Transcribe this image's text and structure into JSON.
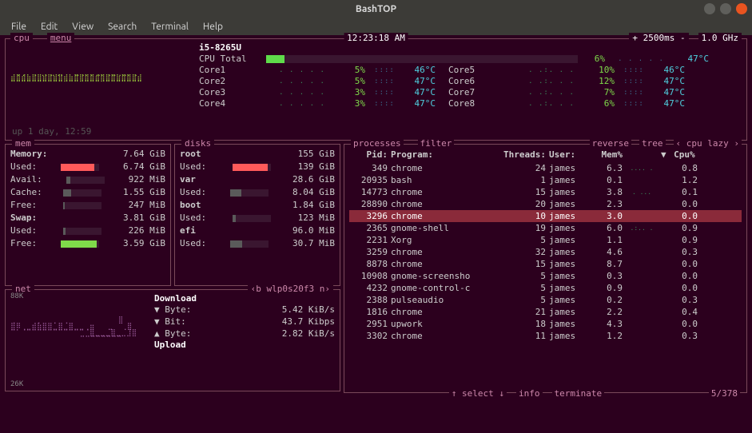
{
  "window": {
    "title": "BashTOP"
  },
  "menubar": [
    "File",
    "Edit",
    "View",
    "Search",
    "Terminal",
    "Help"
  ],
  "cpu": {
    "tab_cpu": "cpu",
    "tab_menu": "menu",
    "model": "i5-8265U",
    "clock": "12:23:18 AM",
    "interval_label": "+ 2500ms -",
    "freq": "1.0 GHz",
    "uptime": "up 1 day, 12:59",
    "total": {
      "label": "CPU Total",
      "pct": "6%",
      "temp": "47°C",
      "bar_pct": 6
    },
    "cores_left": [
      {
        "label": "Core1",
        "pct": "5%",
        "temp": "46°C",
        "tempc": "cyan"
      },
      {
        "label": "Core2",
        "pct": "5%",
        "temp": "47°C",
        "tempc": "cyan"
      },
      {
        "label": "Core3",
        "pct": "3%",
        "temp": "47°C",
        "tempc": "cyan"
      },
      {
        "label": "Core4",
        "pct": "3%",
        "temp": "47°C",
        "tempc": "cyan"
      }
    ],
    "cores_right": [
      {
        "label": "Core5",
        "pct": "10%",
        "temp": "46°C",
        "tempc": "cyan"
      },
      {
        "label": "Core6",
        "pct": "12%",
        "temp": "47°C",
        "tempc": "cyan"
      },
      {
        "label": "Core7",
        "pct": "7%",
        "temp": "47°C",
        "tempc": "cyan"
      },
      {
        "label": "Core8",
        "pct": "6%",
        "temp": "47°C",
        "tempc": "cyan"
      }
    ]
  },
  "mem": {
    "tab": "mem",
    "rows": [
      {
        "label": "Memory:",
        "val": "7.64 GiB",
        "bold": true
      },
      {
        "label": "Used:",
        "val": "6.74 GiB",
        "fill": 88,
        "color": "#ff5a5a"
      },
      {
        "label": "Avail:",
        "val": "922 MiB",
        "fill": 12,
        "color": "#5a5a5a"
      },
      {
        "label": "Cache:",
        "val": "1.55 GiB",
        "fill": 20,
        "color": "#5a5a5a"
      },
      {
        "label": "Free:",
        "val": "247 MiB",
        "fill": 3,
        "color": "#5a5a5a"
      },
      {
        "label": "Swap:",
        "val": "3.81 GiB",
        "bold": true
      },
      {
        "label": "Used:",
        "val": "226 MiB",
        "fill": 6,
        "color": "#5a5a5a"
      },
      {
        "label": "Free:",
        "val": "3.59 GiB",
        "fill": 94,
        "color": "#7fdb4a"
      }
    ]
  },
  "disks": {
    "tab": "disks",
    "rows": [
      {
        "label": "root",
        "val": "155 GiB",
        "bold": true
      },
      {
        "label": "Used:",
        "val": "139 GiB",
        "fill": 90,
        "color": "#ff5a5a"
      },
      {
        "label": "var",
        "val": "28.6 GiB",
        "bold": true
      },
      {
        "label": "Used:",
        "val": "8.04 GiB",
        "fill": 28,
        "color": "#5a5a5a"
      },
      {
        "label": "boot",
        "val": "1.84 GiB",
        "bold": true
      },
      {
        "label": "Used:",
        "val": "123 MiB",
        "fill": 7,
        "color": "#5a5a5a"
      },
      {
        "label": "efi",
        "val": "96.0 MiB",
        "bold": true
      },
      {
        "label": "Used:",
        "val": "30.7 MiB",
        "fill": 32,
        "color": "#5a5a5a"
      }
    ]
  },
  "net": {
    "tab": "net",
    "iface": "‹b wlp0s20f3 n›",
    "top_scale": "88K",
    "bot_scale": "26K",
    "dl_heading": "Download",
    "ul_heading": "Upload",
    "rows": [
      {
        "icon": "▼",
        "label": "Byte:",
        "val": "5.42 KiB/s"
      },
      {
        "icon": "▼",
        "label": "Bit:",
        "val": "43.7 Kibps"
      },
      {
        "icon": "▲",
        "label": "Byte:",
        "val": "2.82 KiB/s"
      }
    ]
  },
  "proc": {
    "tab_processes": "processes",
    "tab_filter": "filter",
    "tab_reverse": "reverse",
    "tab_tree": "tree",
    "tab_sort": "‹ cpu lazy ›",
    "hdr": {
      "pid": "Pid:",
      "prog": "Program:",
      "thr": "Threads:",
      "user": "User:",
      "mem": "Mem%",
      "cpu": "Cpu%",
      "arrow": "▼"
    },
    "rows": [
      {
        "pid": "349",
        "prog": "chrome",
        "thr": "24",
        "user": "james",
        "mem": "6.3",
        "cpu": "0.8",
        "spark": ".... ."
      },
      {
        "pid": "20935",
        "prog": "bash",
        "thr": "1",
        "user": "james",
        "mem": "0.1",
        "cpu": "1.2"
      },
      {
        "pid": "14773",
        "prog": "chrome",
        "thr": "15",
        "user": "james",
        "mem": "3.8",
        "cpu": "0.1",
        "spark": ".  ..."
      },
      {
        "pid": "28890",
        "prog": "chrome",
        "thr": "20",
        "user": "james",
        "mem": "2.3",
        "cpu": "0.0"
      },
      {
        "pid": "3296",
        "prog": "chrome",
        "thr": "10",
        "user": "james",
        "mem": "3.0",
        "cpu": "0.0",
        "sel": true
      },
      {
        "pid": "2365",
        "prog": "gnome-shell",
        "thr": "19",
        "user": "james",
        "mem": "6.0",
        "cpu": "0.9",
        "spark": ".:.. ."
      },
      {
        "pid": "2231",
        "prog": "Xorg",
        "thr": "5",
        "user": "james",
        "mem": "1.1",
        "cpu": "0.9"
      },
      {
        "pid": "3259",
        "prog": "chrome",
        "thr": "32",
        "user": "james",
        "mem": "4.6",
        "cpu": "0.3"
      },
      {
        "pid": "8878",
        "prog": "chrome",
        "thr": "15",
        "user": "james",
        "mem": "8.7",
        "cpu": "0.0"
      },
      {
        "pid": "10908",
        "prog": "gnome-screensho",
        "thr": "5",
        "user": "james",
        "mem": "0.3",
        "cpu": "0.0"
      },
      {
        "pid": "4232",
        "prog": "gnome-control-c",
        "thr": "5",
        "user": "james",
        "mem": "0.9",
        "cpu": "0.0"
      },
      {
        "pid": "2388",
        "prog": "pulseaudio",
        "thr": "5",
        "user": "james",
        "mem": "0.2",
        "cpu": "0.3"
      },
      {
        "pid": "1816",
        "prog": "chrome",
        "thr": "21",
        "user": "james",
        "mem": "2.2",
        "cpu": "0.4"
      },
      {
        "pid": "2951",
        "prog": "upwork",
        "thr": "18",
        "user": "james",
        "mem": "4.3",
        "cpu": "0.0"
      },
      {
        "pid": "3302",
        "prog": "chrome",
        "thr": "11",
        "user": "james",
        "mem": "1.2",
        "cpu": "0.3"
      }
    ],
    "footer": {
      "select": "↑ select ↓",
      "info": "info",
      "terminate": "terminate",
      "count": "5/378"
    }
  }
}
